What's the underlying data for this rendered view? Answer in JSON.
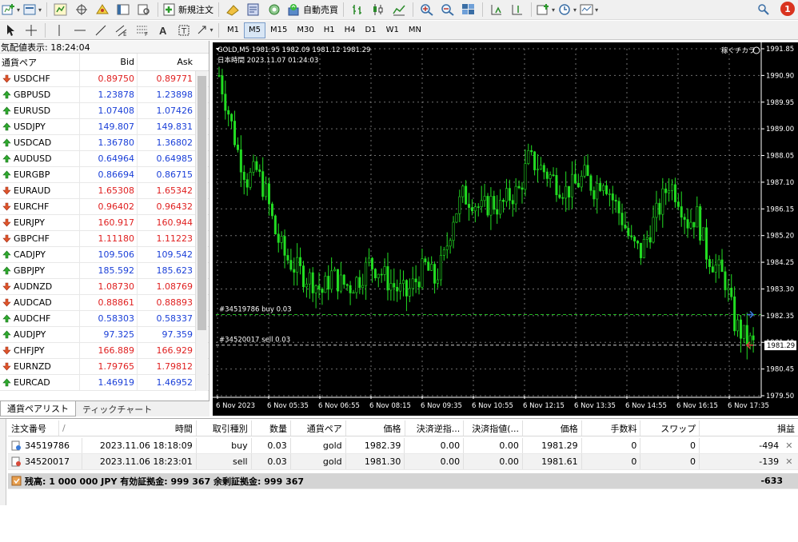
{
  "toolbar": {
    "new_order_label": "新規注文",
    "auto_trade_label": "自動売買",
    "notification_count": "1",
    "timeframes": [
      "M1",
      "M5",
      "M15",
      "M30",
      "H1",
      "H4",
      "D1",
      "W1",
      "MN"
    ],
    "active_timeframe": "M5"
  },
  "market_watch": {
    "title": "気配値表示: 18:24:04",
    "headers": {
      "symbol": "通貨ペア",
      "bid": "Bid",
      "ask": "Ask"
    },
    "rows": [
      {
        "symbol": "USDCHF",
        "bid": "0.89750",
        "ask": "0.89771",
        "dir": "down"
      },
      {
        "symbol": "GBPUSD",
        "bid": "1.23878",
        "ask": "1.23898",
        "dir": "up"
      },
      {
        "symbol": "EURUSD",
        "bid": "1.07408",
        "ask": "1.07426",
        "dir": "up"
      },
      {
        "symbol": "USDJPY",
        "bid": "149.807",
        "ask": "149.831",
        "dir": "up"
      },
      {
        "symbol": "USDCAD",
        "bid": "1.36780",
        "ask": "1.36802",
        "dir": "up"
      },
      {
        "symbol": "AUDUSD",
        "bid": "0.64964",
        "ask": "0.64985",
        "dir": "up"
      },
      {
        "symbol": "EURGBP",
        "bid": "0.86694",
        "ask": "0.86715",
        "dir": "up"
      },
      {
        "symbol": "EURAUD",
        "bid": "1.65308",
        "ask": "1.65342",
        "dir": "down"
      },
      {
        "symbol": "EURCHF",
        "bid": "0.96402",
        "ask": "0.96432",
        "dir": "down"
      },
      {
        "symbol": "EURJPY",
        "bid": "160.917",
        "ask": "160.944",
        "dir": "down"
      },
      {
        "symbol": "GBPCHF",
        "bid": "1.11180",
        "ask": "1.11223",
        "dir": "down"
      },
      {
        "symbol": "CADJPY",
        "bid": "109.506",
        "ask": "109.542",
        "dir": "up"
      },
      {
        "symbol": "GBPJPY",
        "bid": "185.592",
        "ask": "185.623",
        "dir": "up"
      },
      {
        "symbol": "AUDNZD",
        "bid": "1.08730",
        "ask": "1.08769",
        "dir": "down"
      },
      {
        "symbol": "AUDCAD",
        "bid": "0.88861",
        "ask": "0.88893",
        "dir": "down"
      },
      {
        "symbol": "AUDCHF",
        "bid": "0.58303",
        "ask": "0.58337",
        "dir": "up"
      },
      {
        "symbol": "AUDJPY",
        "bid": "97.325",
        "ask": "97.359",
        "dir": "up"
      },
      {
        "symbol": "CHFJPY",
        "bid": "166.889",
        "ask": "166.929",
        "dir": "down"
      },
      {
        "symbol": "EURNZD",
        "bid": "1.79765",
        "ask": "1.79812",
        "dir": "down"
      },
      {
        "symbol": "EURCAD",
        "bid": "1.46919",
        "ask": "1.46952",
        "dir": "up"
      }
    ],
    "tabs": [
      "通貨ペアリスト",
      "ティックチャート"
    ]
  },
  "chart": {
    "header": "GOLD,M5  1981.95 1982.09 1981.12 1981.29",
    "subheader": "日本時間  2023.11.07 01:24:03",
    "badge": "稼ぐチカラ",
    "buy_line_label": "#34519786 buy 0.03",
    "sell_line_label": "#34520017 sell 0.03",
    "current_price_label": "1981.29",
    "y_ticks": [
      "1991.85",
      "1990.90",
      "1989.95",
      "1989.00",
      "1988.05",
      "1987.10",
      "1986.15",
      "1985.20",
      "1984.25",
      "1983.30",
      "1982.35",
      "1981.40",
      "1980.45",
      "1979.50"
    ],
    "x_ticks": [
      "6 Nov 2023",
      "6 Nov 05:35",
      "6 Nov 06:55",
      "6 Nov 08:15",
      "6 Nov 09:35",
      "6 Nov 10:55",
      "6 Nov 12:15",
      "6 Nov 13:35",
      "6 Nov 14:55",
      "6 Nov 16:15",
      "6 Nov 17:35"
    ],
    "colors": {
      "background": "#000000",
      "candle": "#22dd22",
      "grid": "#bbbbbb",
      "buy_line": "#22bb22",
      "sell_line": "#cccccc"
    }
  },
  "chart_data": {
    "type": "candlestick",
    "title": "GOLD,M5",
    "ylim": [
      1979.5,
      1991.85
    ],
    "open": 1981.95,
    "high": 1982.09,
    "low": 1981.12,
    "close": 1981.29,
    "price_track": [
      1990.9,
      1989.6,
      1988.2,
      1987.2,
      1987.5,
      1986.7,
      1985.3,
      1984.5,
      1984.1,
      1983.8,
      1983.6,
      1983.2,
      1983.8,
      1983.5,
      1983.4,
      1983.7,
      1984.2,
      1984.0,
      1983.6,
      1983.3,
      1983.1,
      1983.6,
      1984.1,
      1983.6,
      1984.4,
      1985.9,
      1986.6,
      1986.5,
      1986.1,
      1986.4,
      1986.2,
      1986.6,
      1986.8,
      1987.9,
      1987.7,
      1987.4,
      1987.1,
      1986.8,
      1987.0,
      1987.3,
      1986.9,
      1987.3,
      1986.5,
      1985.8,
      1984.9,
      1984.6,
      1985.4,
      1986.2,
      1987.1,
      1986.6,
      1985.7,
      1985.9,
      1984.6,
      1984.1,
      1983.6,
      1982.1,
      1981.6,
      1981.3
    ],
    "orders": [
      {
        "ticket": "34519786",
        "type": "buy",
        "price": 1982.39
      },
      {
        "ticket": "34520017",
        "type": "sell",
        "price": 1981.3
      }
    ],
    "current_price": 1981.29
  },
  "terminal": {
    "headers": [
      "注文番号",
      "/",
      "時間",
      "取引種別",
      "数量",
      "通貨ペア",
      "価格",
      "決済逆指...",
      "決済指値(...",
      "価格",
      "手数料",
      "スワップ",
      "損益"
    ],
    "orders": [
      {
        "ticket": "34519786",
        "time": "2023.11.06 18:18:09",
        "type": "buy",
        "volume": "0.03",
        "symbol": "gold",
        "price": "1982.39",
        "sl": "0.00",
        "tp": "0.00",
        "current": "1981.29",
        "commission": "0",
        "swap": "0",
        "profit": "-494"
      },
      {
        "ticket": "34520017",
        "time": "2023.11.06 18:23:01",
        "type": "sell",
        "volume": "0.03",
        "symbol": "gold",
        "price": "1981.30",
        "sl": "0.00",
        "tp": "0.00",
        "current": "1981.61",
        "commission": "0",
        "swap": "0",
        "profit": "-139"
      }
    ],
    "balance_text": "残高: 1 000 000 JPY  有効証拠金: 999 367  余剰証拠金: 999 367",
    "total_profit": "-633"
  }
}
